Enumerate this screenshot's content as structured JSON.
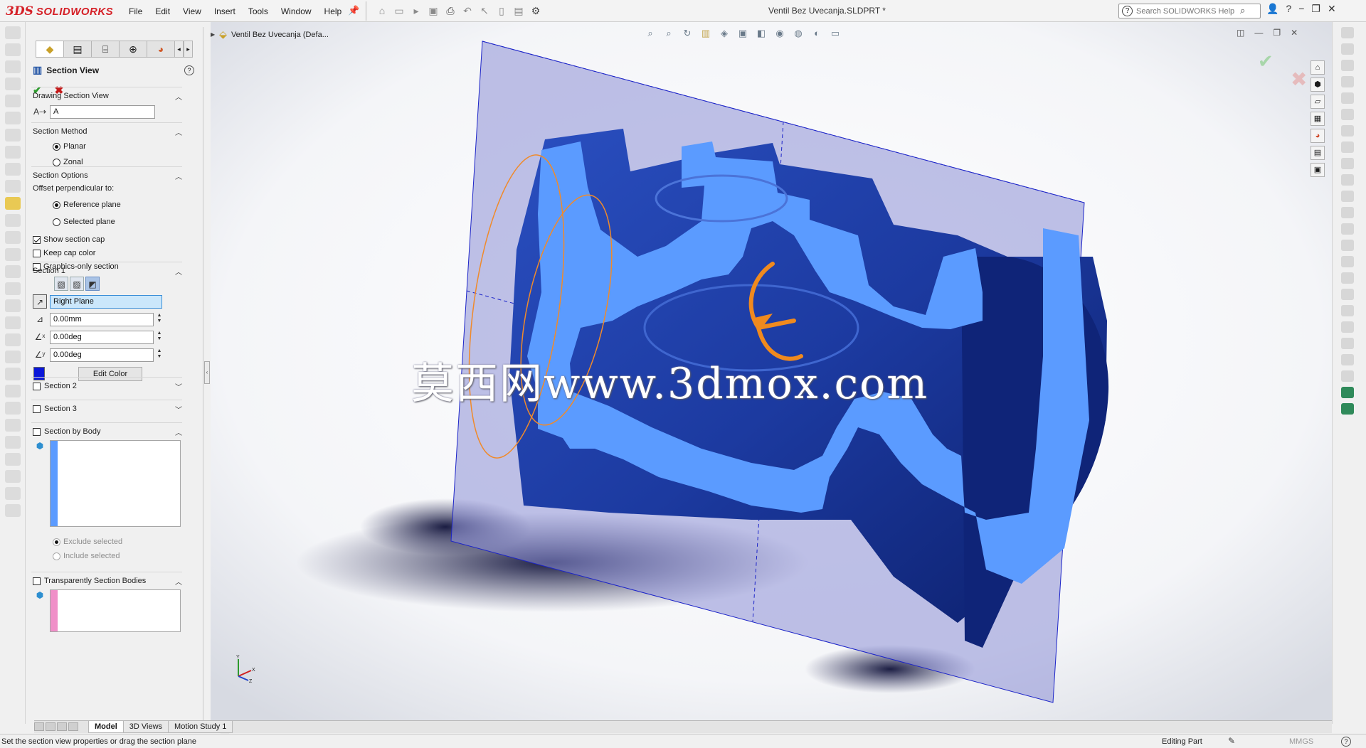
{
  "app": {
    "brand_prefix": "3DS",
    "brand_name": "SOLIDWORKS",
    "document_title": "Ventil Bez Uvecanja.SLDPRT *"
  },
  "menu": [
    "File",
    "Edit",
    "View",
    "Insert",
    "Tools",
    "Window",
    "Help"
  ],
  "help_search": {
    "placeholder": "Search SOLIDWORKS Help"
  },
  "property_manager": {
    "title": "Section View",
    "drawing_section_view": {
      "label": "Drawing Section View",
      "name_value": "A"
    },
    "section_method": {
      "label": "Section Method",
      "options": [
        "Planar",
        "Zonal"
      ],
      "selected": "Planar"
    },
    "section_options": {
      "label": "Section Options",
      "offset_label": "Offset perpendicular to:",
      "offset_options": [
        "Reference plane",
        "Selected plane"
      ],
      "offset_selected": "Reference plane",
      "show_section_cap": "Show section cap",
      "keep_cap_color": "Keep cap color",
      "graphics_only": "Graphics-only section"
    },
    "section1": {
      "label": "Section 1",
      "plane": "Right Plane",
      "offset": "0.00mm",
      "angle_x": "0.00deg",
      "angle_y": "0.00deg",
      "edit_color": "Edit Color",
      "cap_color": "#0a17d8"
    },
    "section2": {
      "label": "Section 2"
    },
    "section3": {
      "label": "Section 3"
    },
    "section_by_body": {
      "label": "Section by Body",
      "exclude": "Exclude selected",
      "include": "Include selected"
    },
    "transparent_bodies": {
      "label": "Transparently Section Bodies"
    }
  },
  "viewport": {
    "tree_item": "Ventil Bez Uvecanja  (Defa...",
    "watermark": "莫西网www.3dmox.com",
    "triad_labels": [
      "Y",
      "X",
      "Z"
    ]
  },
  "bottom_tabs": [
    "Model",
    "3D Views",
    "Motion Study 1"
  ],
  "active_bottom_tab": "Model",
  "status": {
    "message": "Set the section view properties or drag the section plane",
    "mode": "Editing Part",
    "units": "MMGS"
  },
  "colors": {
    "brand_red": "#d52027",
    "cap_blue": "#5b9bff",
    "body_blue": "#1a3da8",
    "plane": "#a9abe0"
  }
}
